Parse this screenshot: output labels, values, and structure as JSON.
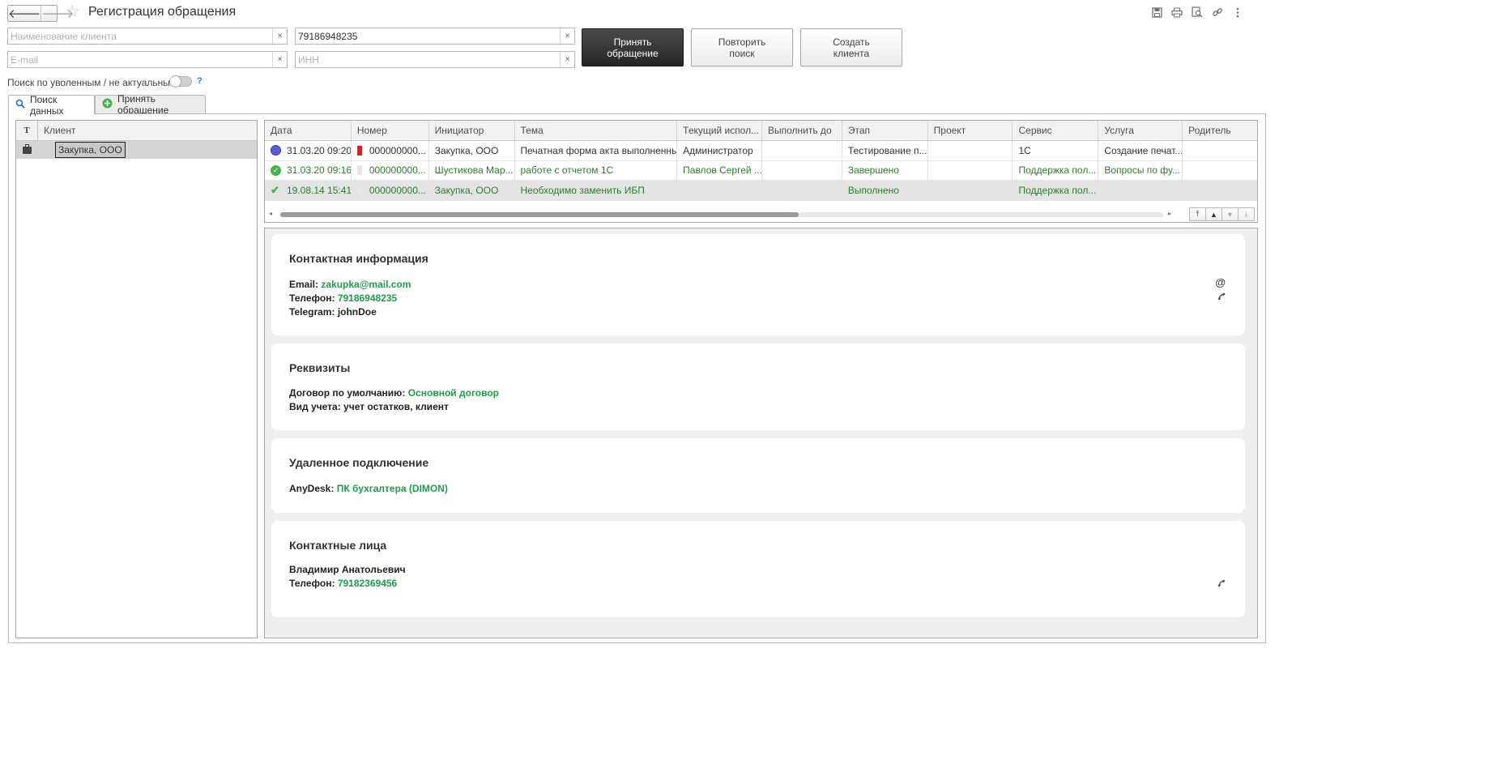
{
  "window": {
    "title": "Регистрация обращения",
    "back_icon": "arrow-left-icon",
    "forward_icon": "arrow-right-icon",
    "favorite_icon": "star-icon",
    "toolbar_icons": [
      "save-icon",
      "print-icon",
      "preview-icon",
      "link-icon",
      "more-icon"
    ]
  },
  "search": {
    "client_name": {
      "placeholder": "Наименование клиента",
      "value": ""
    },
    "phone": {
      "placeholder": "",
      "value": "79186948235"
    },
    "email": {
      "placeholder": "E-mail",
      "value": ""
    },
    "inn": {
      "placeholder": "ИНН",
      "value": ""
    },
    "clear_label": "×",
    "fired_toggle_label": "Поиск по уволенным / не актуальным:",
    "help_label": "?"
  },
  "actions": {
    "accept_line1": "Принять",
    "accept_line2": "обращение",
    "repeat_line1": "Повторить",
    "repeat_line2": "поиск",
    "create_line1": "Создать",
    "create_line2": "клиента"
  },
  "tabs": [
    {
      "label": "Поиск данных",
      "icon": "search-icon"
    },
    {
      "label": "Принять обращение",
      "icon": "plus-circle-icon"
    }
  ],
  "clients": {
    "headers": {
      "type": "T",
      "client": "Клиент"
    },
    "rows": [
      {
        "name": "Закупка, ООО"
      }
    ]
  },
  "requests": {
    "headers": [
      "Дата",
      "Номер",
      "Инициатор",
      "Тема",
      "Текущий испол...",
      "Выполнить до",
      "Этап",
      "Проект",
      "Сервис",
      "Услуга",
      "Родитель"
    ],
    "rows": [
      {
        "date": "31.03.20 09:20",
        "number": "000000000...",
        "initiator": "Закупка, ООО",
        "topic": "Печатная форма акта выполненны...",
        "executor": "Администратор",
        "due": "",
        "stage": "Тестирование п...",
        "project": "",
        "service": "1С",
        "usluga": "Создание печат...",
        "parent": "",
        "status_color": "#5b5bd1",
        "flag_color": "#e01f1f"
      },
      {
        "date": "31.03.20 09:16",
        "number": "000000000...",
        "initiator": "Шустикова Мар...",
        "topic": "работе с отчетом 1С",
        "executor": "Павлов Сергей ...",
        "due": "",
        "stage": "Завершено",
        "project": "",
        "service": "Поддержка пол...",
        "usluga": "Вопросы по фу...",
        "parent": "",
        "status_color": "#4bb04b",
        "flag_color": "#e6e6e6"
      },
      {
        "date": "19.08.14 15:41",
        "number": "000000000...",
        "initiator": "Закупка, ООО",
        "topic": "Необходимо заменить ИБП",
        "executor": "",
        "due": "",
        "stage": "Выполнено",
        "project": "",
        "service": "Поддержка пол...",
        "usluga": "",
        "parent": "",
        "status_color": "#4bb04b",
        "flag_color": "#e6e6e6"
      }
    ]
  },
  "contact_info": {
    "title": "Контактная информация",
    "email_label": "Email:",
    "email": "zakupka@mail.com",
    "phone_label": "Телефон:",
    "phone": "79186948235",
    "telegram_label": "Telegram:",
    "telegram": "johnDoe",
    "email_icon": "at-icon",
    "phone_icon": "phone-icon"
  },
  "requisites": {
    "title": "Реквизиты",
    "contract_label": "Договор по умолчанию:",
    "contract": "Основной договор",
    "account_label": "Вид учета:",
    "account": "учет остатков, клиент"
  },
  "remote": {
    "title": "Удаленное подключение",
    "anydesk_label": "AnyDesk:",
    "anydesk": "ПК бухгалтера (DIMON)"
  },
  "contacts": {
    "title": "Контактные лица",
    "person": "Владимир Анатольевич",
    "phone_label": "Телефон:",
    "phone": "79182369456",
    "phone_icon": "phone-icon"
  },
  "colors": {
    "link": "#1e9b4a",
    "accent": "#2a7ad5",
    "dark_button": "#2d2d2d"
  }
}
